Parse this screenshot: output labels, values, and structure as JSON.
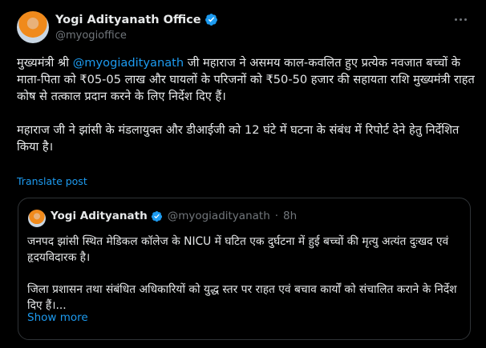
{
  "colors": {
    "background": "#000000",
    "text": "#e7e9ea",
    "muted": "#71767b",
    "link": "#1d9bf0",
    "verified": "#1d9bf0"
  },
  "tweet": {
    "author_name": "Yogi Adityanath Office",
    "author_handle": "@myogioffice",
    "avatar_icon": "avatar",
    "more_icon": "more-horizontal-icon",
    "body_part1": "मुख्यमंत्री श्री ",
    "mention": "@myogiadityanath",
    "body_part2": " जी महाराज ने असमय काल-कवलित हुए प्रत्येक नवजात बच्चों के माता-पिता को ₹05-05 लाख और घायलों के परिजनों को ₹50-50 हजार की सहायता राशि मुख्यमंत्री राहत कोष से तत्काल प्रदान करने के लिए निर्देश दिए हैं।",
    "body_para2": "महाराज जी ने झांसी के मंडलायुक्त और डीआईजी को 12 घंटे में घटना के संबंध में रिपोर्ट देने हेतु निर्देशित किया है।",
    "translate_label": "Translate post"
  },
  "quoted": {
    "author_name": "Yogi Adityanath",
    "author_handle": "@myogiadityanath",
    "separator": "·",
    "time": "8h",
    "para1": "जनपद झांसी स्थित मेडिकल कॉलेज के NICU में घटित एक दुर्घटना में हुई बच्चों की मृत्यु अत्यंत दुःखद एवं हृदयविदारक है।",
    "para2": "जिला प्रशासन तथा संबंधित अधिकारियों को युद्ध स्तर पर राहत एवं बचाव कार्यों को संचालित कराने के निर्देश दिए हैं।...",
    "show_more": "Show more"
  }
}
